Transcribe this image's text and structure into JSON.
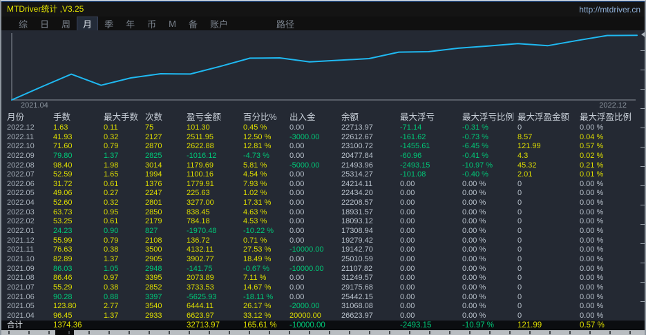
{
  "titlebar": {
    "title": "MTDriver统计 ,V3.25",
    "url": "http://mtdriver.cn"
  },
  "menu": {
    "items": [
      "综",
      "日",
      "周",
      "月",
      "季",
      "年",
      "币",
      "M",
      "备",
      "账户",
      "路径"
    ],
    "selected": "月"
  },
  "chart_data": {
    "type": "line",
    "title": "",
    "xlabel": "",
    "ylabel": "",
    "x": [
      "start",
      "2021.04",
      "2021.05",
      "2021.06",
      "2021.07",
      "2021.08",
      "2021.09",
      "2021.10",
      "2021.11",
      "2021.12",
      "2022.01",
      "2022.02",
      "2022.03",
      "2022.04",
      "2022.05",
      "2022.06",
      "2022.07",
      "2022.08",
      "2022.09",
      "2022.10",
      "2022.11",
      "2022.12"
    ],
    "values": [
      0,
      6623.97,
      13068.08,
      7442.15,
      11175.68,
      13249.57,
      13107.82,
      17010.59,
      21142.7,
      21279.42,
      19308.94,
      20093.12,
      20931.57,
      24208.57,
      24434.2,
      26214.11,
      27314.27,
      28493.96,
      27477.84,
      30100.72,
      32612.67,
      32713.97
    ],
    "ylim": [
      0,
      33500
    ],
    "x_start_label": "2021.04",
    "x_end_label": "2022.12",
    "line_color": "#1fb9f2",
    "grid": false,
    "legend": false
  },
  "table": {
    "columns": [
      "月份",
      "手数",
      "最大手数",
      "次数",
      "盈亏金额",
      "百分比%",
      "出入金",
      "余额",
      "最大浮亏",
      "最大浮亏比例",
      "最大浮盈金额",
      "最大浮盈比例"
    ],
    "rows": [
      [
        [
          "2022.12",
          "m"
        ],
        [
          "1.63",
          "y"
        ],
        [
          "0.11",
          "y"
        ],
        [
          "75",
          "y"
        ],
        [
          "101.30",
          "y"
        ],
        [
          "0.45 %",
          "y"
        ],
        [
          "0.00",
          "w"
        ],
        [
          "22713.97",
          "w"
        ],
        [
          "-71.14",
          "g"
        ],
        [
          "-0.31 %",
          "g"
        ],
        [
          "0",
          "w"
        ],
        [
          "0.00 %",
          "w"
        ]
      ],
      [
        [
          "2022.11",
          "m"
        ],
        [
          "41.93",
          "y"
        ],
        [
          "0.32",
          "y"
        ],
        [
          "2127",
          "y"
        ],
        [
          "2511.95",
          "y"
        ],
        [
          "12.50 %",
          "y"
        ],
        [
          "-3000.00",
          "g"
        ],
        [
          "22612.67",
          "w"
        ],
        [
          "-161.62",
          "g"
        ],
        [
          "-0.73 %",
          "g"
        ],
        [
          "8.57",
          "y"
        ],
        [
          "0.04 %",
          "y"
        ]
      ],
      [
        [
          "2022.10",
          "m"
        ],
        [
          "71.60",
          "y"
        ],
        [
          "0.79",
          "y"
        ],
        [
          "2870",
          "y"
        ],
        [
          "2622.88",
          "y"
        ],
        [
          "12.81 %",
          "y"
        ],
        [
          "0.00",
          "w"
        ],
        [
          "23100.72",
          "w"
        ],
        [
          "-1455.61",
          "g"
        ],
        [
          "-6.45 %",
          "g"
        ],
        [
          "121.99",
          "y"
        ],
        [
          "0.57 %",
          "y"
        ]
      ],
      [
        [
          "2022.09",
          "m"
        ],
        [
          "79.80",
          "g"
        ],
        [
          "1.37",
          "g"
        ],
        [
          "2825",
          "g"
        ],
        [
          "-1016.12",
          "g"
        ],
        [
          "-4.73 %",
          "g"
        ],
        [
          "0.00",
          "w"
        ],
        [
          "20477.84",
          "w"
        ],
        [
          "-60.96",
          "g"
        ],
        [
          "-0.41 %",
          "g"
        ],
        [
          "4.3",
          "y"
        ],
        [
          "0.02 %",
          "y"
        ]
      ],
      [
        [
          "2022.08",
          "m"
        ],
        [
          "98.40",
          "y"
        ],
        [
          "1.98",
          "y"
        ],
        [
          "3014",
          "y"
        ],
        [
          "1179.69",
          "y"
        ],
        [
          "5.81 %",
          "y"
        ],
        [
          "-5000.00",
          "g"
        ],
        [
          "21493.96",
          "w"
        ],
        [
          "-2493.15",
          "g"
        ],
        [
          "-10.97 %",
          "g"
        ],
        [
          "45.32",
          "y"
        ],
        [
          "0.21 %",
          "y"
        ]
      ],
      [
        [
          "2022.07",
          "m"
        ],
        [
          "52.59",
          "y"
        ],
        [
          "1.65",
          "y"
        ],
        [
          "1994",
          "y"
        ],
        [
          "1100.16",
          "y"
        ],
        [
          "4.54 %",
          "y"
        ],
        [
          "0.00",
          "w"
        ],
        [
          "25314.27",
          "w"
        ],
        [
          "-101.08",
          "g"
        ],
        [
          "-0.40 %",
          "g"
        ],
        [
          "2.01",
          "y"
        ],
        [
          "0.01 %",
          "y"
        ]
      ],
      [
        [
          "2022.06",
          "m"
        ],
        [
          "31.72",
          "y"
        ],
        [
          "0.61",
          "y"
        ],
        [
          "1376",
          "y"
        ],
        [
          "1779.91",
          "y"
        ],
        [
          "7.93 %",
          "y"
        ],
        [
          "0.00",
          "w"
        ],
        [
          "24214.11",
          "w"
        ],
        [
          "0.00",
          "w"
        ],
        [
          "0.00 %",
          "w"
        ],
        [
          "0",
          "w"
        ],
        [
          "0.00 %",
          "w"
        ]
      ],
      [
        [
          "2022.05",
          "m"
        ],
        [
          "49.06",
          "y"
        ],
        [
          "0.27",
          "y"
        ],
        [
          "2247",
          "y"
        ],
        [
          "225.63",
          "y"
        ],
        [
          "1.02 %",
          "y"
        ],
        [
          "0.00",
          "w"
        ],
        [
          "22434.20",
          "w"
        ],
        [
          "0.00",
          "w"
        ],
        [
          "0.00 %",
          "w"
        ],
        [
          "0",
          "w"
        ],
        [
          "0.00 %",
          "w"
        ]
      ],
      [
        [
          "2022.04",
          "m"
        ],
        [
          "52.60",
          "y"
        ],
        [
          "0.32",
          "y"
        ],
        [
          "2801",
          "y"
        ],
        [
          "3277.00",
          "y"
        ],
        [
          "17.31 %",
          "y"
        ],
        [
          "0.00",
          "w"
        ],
        [
          "22208.57",
          "w"
        ],
        [
          "0.00",
          "w"
        ],
        [
          "0.00 %",
          "w"
        ],
        [
          "0",
          "w"
        ],
        [
          "0.00 %",
          "w"
        ]
      ],
      [
        [
          "2022.03",
          "m"
        ],
        [
          "63.73",
          "y"
        ],
        [
          "0.95",
          "y"
        ],
        [
          "2850",
          "y"
        ],
        [
          "838.45",
          "y"
        ],
        [
          "4.63 %",
          "y"
        ],
        [
          "0.00",
          "w"
        ],
        [
          "18931.57",
          "w"
        ],
        [
          "0.00",
          "w"
        ],
        [
          "0.00 %",
          "w"
        ],
        [
          "0",
          "w"
        ],
        [
          "0.00 %",
          "w"
        ]
      ],
      [
        [
          "2022.02",
          "m"
        ],
        [
          "53.25",
          "y"
        ],
        [
          "0.61",
          "y"
        ],
        [
          "2179",
          "y"
        ],
        [
          "784.18",
          "y"
        ],
        [
          "4.53 %",
          "y"
        ],
        [
          "0.00",
          "w"
        ],
        [
          "18093.12",
          "w"
        ],
        [
          "0.00",
          "w"
        ],
        [
          "0.00 %",
          "w"
        ],
        [
          "0",
          "w"
        ],
        [
          "0.00 %",
          "w"
        ]
      ],
      [
        [
          "2022.01",
          "m"
        ],
        [
          "24.23",
          "g"
        ],
        [
          "0.90",
          "g"
        ],
        [
          "827",
          "g"
        ],
        [
          "-1970.48",
          "g"
        ],
        [
          "-10.22 %",
          "g"
        ],
        [
          "0.00",
          "w"
        ],
        [
          "17308.94",
          "w"
        ],
        [
          "0.00",
          "w"
        ],
        [
          "0.00 %",
          "w"
        ],
        [
          "0",
          "w"
        ],
        [
          "0.00 %",
          "w"
        ]
      ],
      [
        [
          "2021.12",
          "m"
        ],
        [
          "55.99",
          "y"
        ],
        [
          "0.79",
          "y"
        ],
        [
          "2108",
          "y"
        ],
        [
          "136.72",
          "y"
        ],
        [
          "0.71 %",
          "y"
        ],
        [
          "0.00",
          "w"
        ],
        [
          "19279.42",
          "w"
        ],
        [
          "0.00",
          "w"
        ],
        [
          "0.00 %",
          "w"
        ],
        [
          "0",
          "w"
        ],
        [
          "0.00 %",
          "w"
        ]
      ],
      [
        [
          "2021.11",
          "m"
        ],
        [
          "76.63",
          "y"
        ],
        [
          "0.38",
          "y"
        ],
        [
          "3500",
          "y"
        ],
        [
          "4132.11",
          "y"
        ],
        [
          "27.53 %",
          "y"
        ],
        [
          "-10000.00",
          "g"
        ],
        [
          "19142.70",
          "w"
        ],
        [
          "0.00",
          "w"
        ],
        [
          "0.00 %",
          "w"
        ],
        [
          "0",
          "w"
        ],
        [
          "0.00 %",
          "w"
        ]
      ],
      [
        [
          "2021.10",
          "m"
        ],
        [
          "82.89",
          "y"
        ],
        [
          "1.37",
          "y"
        ],
        [
          "2905",
          "y"
        ],
        [
          "3902.77",
          "y"
        ],
        [
          "18.49 %",
          "y"
        ],
        [
          "0.00",
          "w"
        ],
        [
          "25010.59",
          "w"
        ],
        [
          "0.00",
          "w"
        ],
        [
          "0.00 %",
          "w"
        ],
        [
          "0",
          "w"
        ],
        [
          "0.00 %",
          "w"
        ]
      ],
      [
        [
          "2021.09",
          "m"
        ],
        [
          "86.03",
          "g"
        ],
        [
          "1.05",
          "g"
        ],
        [
          "2948",
          "g"
        ],
        [
          "-141.75",
          "g"
        ],
        [
          "-0.67 %",
          "g"
        ],
        [
          "-10000.00",
          "g"
        ],
        [
          "21107.82",
          "w"
        ],
        [
          "0.00",
          "w"
        ],
        [
          "0.00 %",
          "w"
        ],
        [
          "0",
          "w"
        ],
        [
          "0.00 %",
          "w"
        ]
      ],
      [
        [
          "2021.08",
          "m"
        ],
        [
          "86.46",
          "y"
        ],
        [
          "0.97",
          "y"
        ],
        [
          "3395",
          "y"
        ],
        [
          "2073.89",
          "y"
        ],
        [
          "7.11 %",
          "y"
        ],
        [
          "0.00",
          "w"
        ],
        [
          "31249.57",
          "w"
        ],
        [
          "0.00",
          "w"
        ],
        [
          "0.00 %",
          "w"
        ],
        [
          "0",
          "w"
        ],
        [
          "0.00 %",
          "w"
        ]
      ],
      [
        [
          "2021.07",
          "m"
        ],
        [
          "55.29",
          "y"
        ],
        [
          "0.38",
          "y"
        ],
        [
          "2852",
          "y"
        ],
        [
          "3733.53",
          "y"
        ],
        [
          "14.67 %",
          "y"
        ],
        [
          "0.00",
          "w"
        ],
        [
          "29175.68",
          "w"
        ],
        [
          "0.00",
          "w"
        ],
        [
          "0.00 %",
          "w"
        ],
        [
          "0",
          "w"
        ],
        [
          "0.00 %",
          "w"
        ]
      ],
      [
        [
          "2021.06",
          "m"
        ],
        [
          "90.28",
          "g"
        ],
        [
          "0.88",
          "g"
        ],
        [
          "3397",
          "g"
        ],
        [
          "-5625.93",
          "g"
        ],
        [
          "-18.11 %",
          "g"
        ],
        [
          "0.00",
          "w"
        ],
        [
          "25442.15",
          "w"
        ],
        [
          "0.00",
          "w"
        ],
        [
          "0.00 %",
          "w"
        ],
        [
          "0",
          "w"
        ],
        [
          "0.00 %",
          "w"
        ]
      ],
      [
        [
          "2021.05",
          "m"
        ],
        [
          "123.80",
          "y"
        ],
        [
          "2.77",
          "y"
        ],
        [
          "3540",
          "y"
        ],
        [
          "6444.11",
          "y"
        ],
        [
          "26.17 %",
          "y"
        ],
        [
          "-2000.00",
          "g"
        ],
        [
          "31068.08",
          "w"
        ],
        [
          "0.00",
          "w"
        ],
        [
          "0.00 %",
          "w"
        ],
        [
          "0",
          "w"
        ],
        [
          "0.00 %",
          "w"
        ]
      ],
      [
        [
          "2021.04",
          "m"
        ],
        [
          "96.45",
          "y"
        ],
        [
          "1.37",
          "y"
        ],
        [
          "2933",
          "y"
        ],
        [
          "6623.97",
          "y"
        ],
        [
          "33.12 %",
          "y"
        ],
        [
          "20000.00",
          "y"
        ],
        [
          "26623.97",
          "w"
        ],
        [
          "0.00",
          "w"
        ],
        [
          "0.00 %",
          "w"
        ],
        [
          "0",
          "w"
        ],
        [
          "0.00 %",
          "w"
        ]
      ]
    ],
    "total": [
      [
        "合计",
        "w"
      ],
      [
        "1374.36",
        "y"
      ],
      [
        "",
        ""
      ],
      [
        "",
        ""
      ],
      [
        "32713.97",
        "y"
      ],
      [
        "165.61 %",
        "y"
      ],
      [
        "-10000.00",
        "g"
      ],
      [
        "",
        ""
      ],
      [
        "-2493.15",
        "g"
      ],
      [
        "-10.97 %",
        "g"
      ],
      [
        "121.99",
        "y"
      ],
      [
        "0.57 %",
        "y"
      ]
    ]
  },
  "colors": {
    "positive_yellow": "#dede00",
    "negative_green": "#00c878",
    "neutral_text": "#b9c2cc",
    "chart_line": "#1fb9f2",
    "background": "#242933",
    "total_row_bg": "#0b0d10"
  }
}
